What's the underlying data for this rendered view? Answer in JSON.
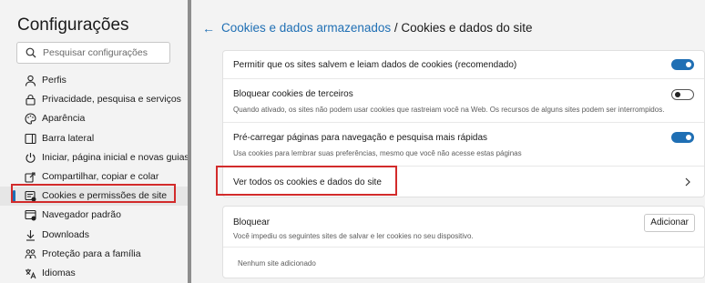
{
  "sidebar": {
    "title": "Configurações",
    "search_placeholder": "Pesquisar configurações",
    "items": [
      {
        "label": "Perfis",
        "icon": "profile-icon"
      },
      {
        "label": "Privacidade, pesquisa e serviços",
        "icon": "lock-icon"
      },
      {
        "label": "Aparência",
        "icon": "palette-icon"
      },
      {
        "label": "Barra lateral",
        "icon": "sidebar-icon"
      },
      {
        "label": "Iniciar, página inicial e novas guias",
        "icon": "power-icon"
      },
      {
        "label": "Compartilhar, copiar e colar",
        "icon": "share-icon"
      },
      {
        "label": "Cookies e permissões de site",
        "icon": "site-permissions-icon",
        "active": true
      },
      {
        "label": "Navegador padrão",
        "icon": "browser-icon"
      },
      {
        "label": "Downloads",
        "icon": "download-icon"
      },
      {
        "label": "Proteção para a família",
        "icon": "family-icon"
      },
      {
        "label": "Idiomas",
        "icon": "language-icon"
      }
    ]
  },
  "header": {
    "back_icon": "←",
    "link": "Cookies e dados armazenados",
    "separator": " / ",
    "current": "Cookies e dados do site"
  },
  "settings": {
    "allow_cookies": {
      "label": "Permitir que os sites salvem e leiam dados de cookies (recomendado)",
      "on": true
    },
    "block_third_party": {
      "label": "Bloquear cookies de terceiros",
      "description": "Quando ativado, os sites não podem usar cookies que rastreiam você na Web. Os recursos de alguns sites podem ser interrompidos.",
      "on": false
    },
    "preload": {
      "label": "Pré-carregar páginas para navegação e pesquisa mais rápidas",
      "description": "Usa cookies para lembrar suas preferências, mesmo que você não acesse estas páginas",
      "on": true
    },
    "see_all": {
      "label": "Ver todos os cookies e dados do site"
    }
  },
  "block_section": {
    "title": "Bloquear",
    "description": "Você impediu os seguintes sites de salvar e ler cookies no seu dispositivo.",
    "add_button": "Adicionar",
    "empty_text": "Nenhum site adicionado"
  },
  "colors": {
    "accent": "#1f6fb4",
    "highlight": "#d22b2b"
  }
}
